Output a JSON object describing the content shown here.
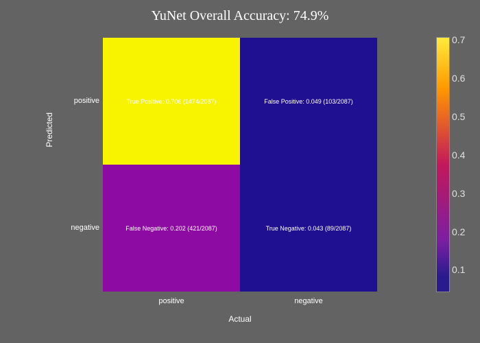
{
  "chart_data": {
    "type": "heatmap",
    "title": "YuNet Overall Accuracy: 74.9%",
    "xlabel": "Actual",
    "ylabel": "Predicted",
    "x_categories": [
      "positive",
      "negative"
    ],
    "y_categories": [
      "positive",
      "negative"
    ],
    "values": [
      [
        0.706,
        0.049
      ],
      [
        0.202,
        0.043
      ]
    ],
    "counts": [
      [
        1474,
        103
      ],
      [
        421,
        89
      ]
    ],
    "total": 2087,
    "cell_labels": [
      [
        "True Positive: 0.706 (1474/2087)",
        "False Positive: 0.049 (103/2087)"
      ],
      [
        "False Negative: 0.202 (421/2087)",
        "True Negative: 0.043 (89/2087)"
      ]
    ],
    "cell_colors": [
      [
        "#F8F400",
        "#1E1090"
      ],
      [
        "#8D0BA2",
        "#1E1090"
      ]
    ],
    "colorbar": {
      "min": 0.043,
      "max": 0.706,
      "ticks": [
        0.1,
        0.2,
        0.3,
        0.4,
        0.5,
        0.6,
        0.7
      ]
    }
  }
}
